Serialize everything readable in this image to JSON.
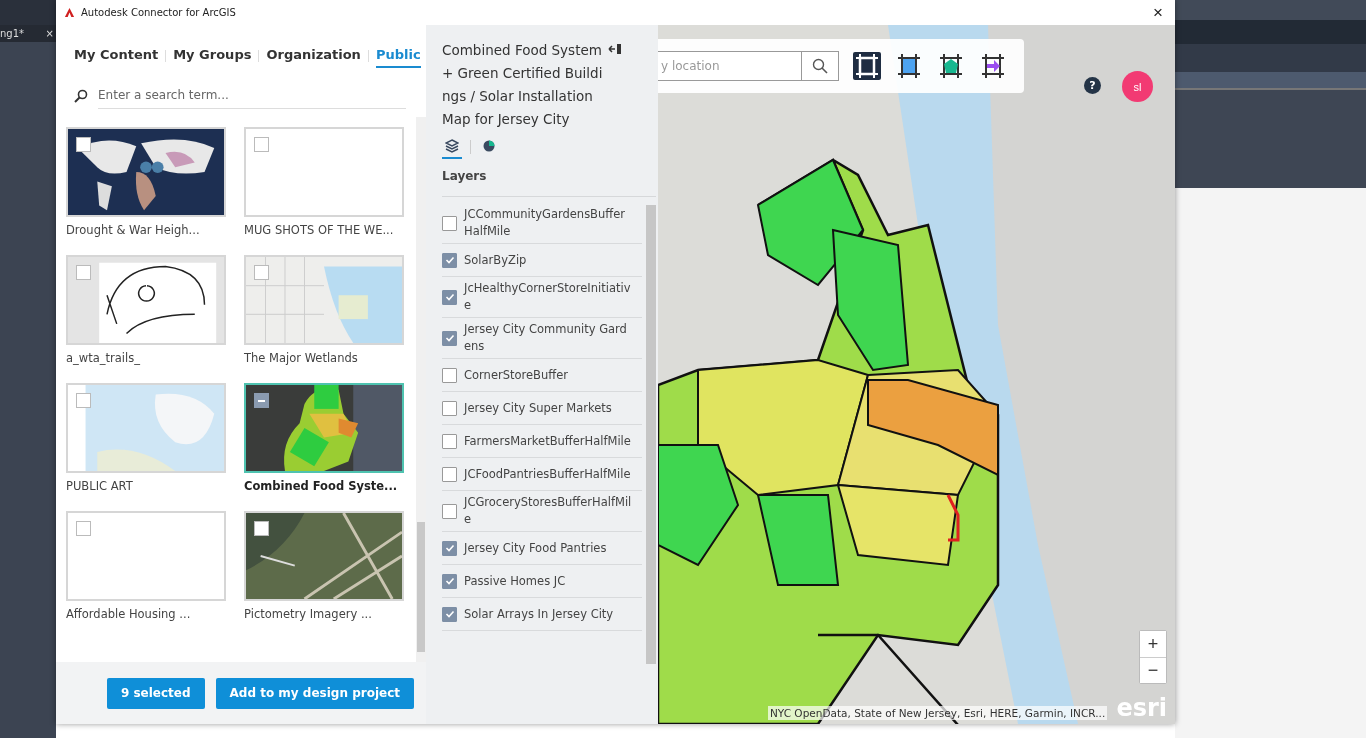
{
  "desktop": {
    "tab_label": "ng1*",
    "tab_close": "×"
  },
  "window": {
    "title": "Autodesk Connector for ArcGIS",
    "close": "×"
  },
  "tabs": [
    {
      "label": "My Content",
      "selected": false
    },
    {
      "label": "My Groups",
      "selected": false
    },
    {
      "label": "Organization",
      "selected": false
    },
    {
      "label": "Public",
      "selected": true
    }
  ],
  "search": {
    "placeholder": "Enter a search term..."
  },
  "items": [
    {
      "title": "Drought & War Heigh...",
      "kind": "world",
      "selected": false
    },
    {
      "title": "MUG SHOTS OF THE WE...",
      "kind": "blank",
      "selected": false
    },
    {
      "title": "a_wta_trails_",
      "kind": "sketch",
      "selected": false
    },
    {
      "title": "The Major Wetlands",
      "kind": "streets",
      "selected": false
    },
    {
      "title": "PUBLIC ART",
      "kind": "arctic",
      "selected": false
    },
    {
      "title": "Combined Food Syste...",
      "kind": "choropleth",
      "selected": true
    },
    {
      "title": "Affordable Housing ...",
      "kind": "blank",
      "selected": false
    },
    {
      "title": "Pictometry Imagery ...",
      "kind": "aerial",
      "selected": false
    }
  ],
  "footer": {
    "count_button": "9 selected",
    "add_button": "Add to my design project"
  },
  "details": {
    "title": "Combined Food System + Green Certified Buildings / Solar Installation Map for Jersey City",
    "view_tabs": [
      {
        "kind": "layers",
        "selected": true
      },
      {
        "kind": "legend",
        "selected": false
      }
    ],
    "layers_heading": "Layers",
    "layers": [
      {
        "name": "JCCommunityGardensBufferHalfMile",
        "checked": false
      },
      {
        "name": "SolarByZip",
        "checked": true
      },
      {
        "name": "JcHealthyCornerStoreInitiative",
        "checked": true
      },
      {
        "name": "Jersey City Community Gardens",
        "checked": true
      },
      {
        "name": "CornerStoreBuffer",
        "checked": false
      },
      {
        "name": "Jersey City Super Markets",
        "checked": false
      },
      {
        "name": "FarmersMarketBufferHalfMile",
        "checked": false
      },
      {
        "name": "JCFoodPantriesBufferHalfMile",
        "checked": false
      },
      {
        "name": "JCGroceryStoresBufferHalfMile",
        "checked": false
      },
      {
        "name": "Jersey City Food Pantries",
        "checked": true
      },
      {
        "name": "Passive Homes JC",
        "checked": true
      },
      {
        "name": "Solar Arrays In Jersey City",
        "checked": true
      }
    ]
  },
  "map": {
    "search_placeholder": "y location",
    "tools": [
      {
        "kind": "frame",
        "selected": true
      },
      {
        "kind": "square",
        "selected": false
      },
      {
        "kind": "pentagon",
        "selected": false
      },
      {
        "kind": "arrow",
        "selected": false
      }
    ],
    "help": "?",
    "avatar": "sl",
    "zoom_in": "+",
    "zoom_out": "−",
    "attribution": "NYC OpenData, State of New Jersey, Esri, HERE, Garmin, INCR...",
    "logo": "esri"
  }
}
